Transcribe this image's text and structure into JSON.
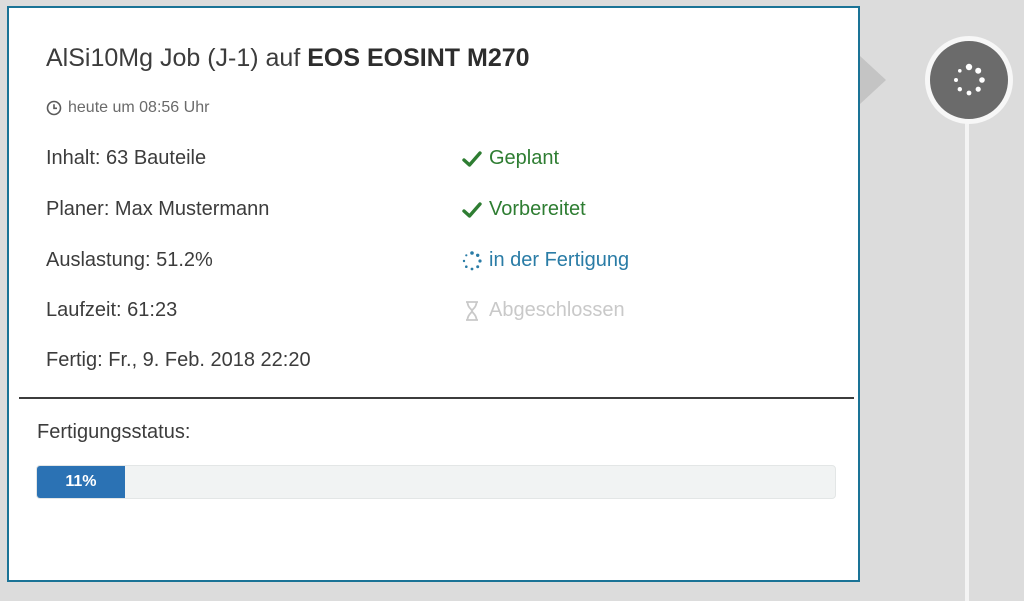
{
  "job": {
    "title_prefix": "AlSi10Mg Job (J-1) auf",
    "machine": "EOS EOSINT M270",
    "time": "heute um 08:56 Uhr",
    "time_icon": "clock-icon"
  },
  "details": [
    "Inhalt: 63 Bauteile",
    "Planer: Max Mustermann",
    "Auslastung: 51.2%",
    "Laufzeit: 61:23",
    "Fertig: Fr., 9. Feb. 2018 22:20"
  ],
  "steps": [
    {
      "label": "Geplant",
      "state": "done",
      "icon": "checkmark-icon"
    },
    {
      "label": "Vorbereitet",
      "state": "done",
      "icon": "checkmark-icon"
    },
    {
      "label": "in der Fertigung",
      "state": "active",
      "icon": "spinner-icon"
    },
    {
      "label": "Abgeschlossen",
      "state": "pending",
      "icon": "hourglass-icon"
    }
  ],
  "production": {
    "label": "Fertigungsstatus:",
    "progress_percent": 11,
    "progress_text": "11%"
  },
  "timeline": {
    "node_icon": "spinner-icon"
  },
  "colors": {
    "card_border": "#1a7396",
    "done": "#2e7d32",
    "active": "#2a7ca6",
    "pending": "#c9c9c9",
    "progress": "#2b72b4"
  }
}
